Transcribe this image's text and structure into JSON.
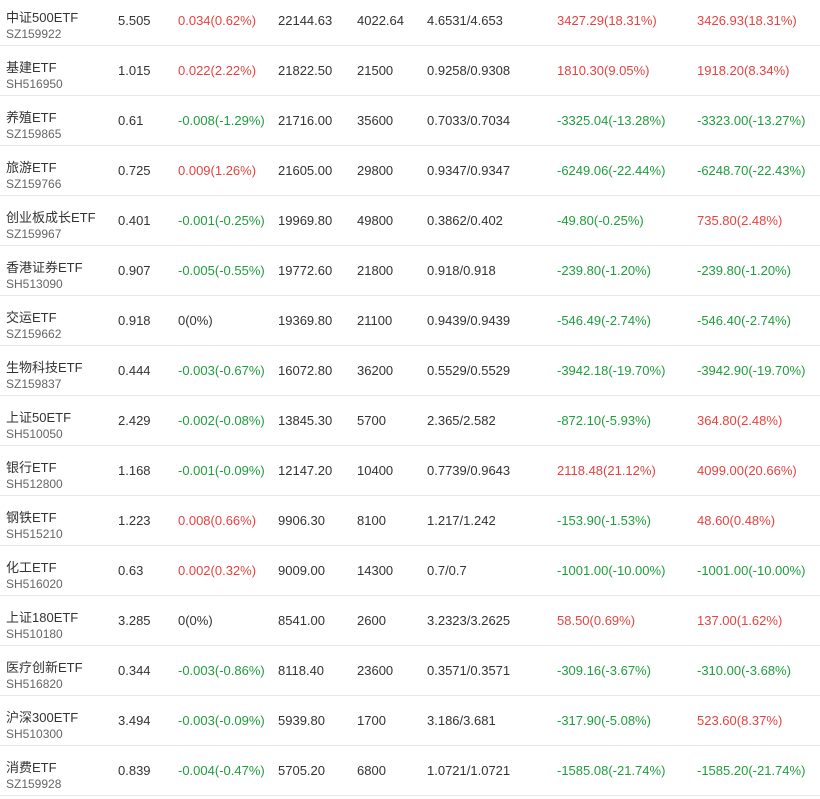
{
  "colors": {
    "up": "#e64340",
    "down": "#1e9e3c",
    "flat": "#333333"
  },
  "rows": [
    {
      "name": "中证500ETF",
      "code": "SZ159922",
      "price": "5.505",
      "change": "0.034(0.62%)",
      "change_dir": "up",
      "col3": "22144.63",
      "col4": "4022.64",
      "col5": "4.6531/4.653",
      "col6": "3427.29(18.31%)",
      "col6_dir": "up",
      "col7": "3426.93(18.31%)",
      "col7_dir": "up"
    },
    {
      "name": "基建ETF",
      "code": "SH516950",
      "price": "1.015",
      "change": "0.022(2.22%)",
      "change_dir": "up",
      "col3": "21822.50",
      "col4": "21500",
      "col5": "0.9258/0.9308",
      "col6": "1810.30(9.05%)",
      "col6_dir": "up",
      "col7": "1918.20(8.34%)",
      "col7_dir": "up"
    },
    {
      "name": "养殖ETF",
      "code": "SZ159865",
      "price": "0.61",
      "change": "-0.008(-1.29%)",
      "change_dir": "down",
      "col3": "21716.00",
      "col4": "35600",
      "col5": "0.7033/0.7034",
      "col6": "-3325.04(-13.28%)",
      "col6_dir": "down",
      "col7": "-3323.00(-13.27%)",
      "col7_dir": "down"
    },
    {
      "name": "旅游ETF",
      "code": "SZ159766",
      "price": "0.725",
      "change": "0.009(1.26%)",
      "change_dir": "up",
      "col3": "21605.00",
      "col4": "29800",
      "col5": "0.9347/0.9347",
      "col6": "-6249.06(-22.44%)",
      "col6_dir": "down",
      "col7": "-6248.70(-22.43%)",
      "col7_dir": "down"
    },
    {
      "name": "创业板成长ETF",
      "code": "SZ159967",
      "price": "0.401",
      "change": "-0.001(-0.25%)",
      "change_dir": "down",
      "col3": "19969.80",
      "col4": "49800",
      "col5": "0.3862/0.402",
      "col6": "-49.80(-0.25%)",
      "col6_dir": "down",
      "col7": "735.80(2.48%)",
      "col7_dir": "up"
    },
    {
      "name": "香港证券ETF",
      "code": "SH513090",
      "price": "0.907",
      "change": "-0.005(-0.55%)",
      "change_dir": "down",
      "col3": "19772.60",
      "col4": "21800",
      "col5": "0.918/0.918",
      "col6": "-239.80(-1.20%)",
      "col6_dir": "down",
      "col7": "-239.80(-1.20%)",
      "col7_dir": "down"
    },
    {
      "name": "交运ETF",
      "code": "SZ159662",
      "price": "0.918",
      "change": "0(0%)",
      "change_dir": "flat",
      "col3": "19369.80",
      "col4": "21100",
      "col5": "0.9439/0.9439",
      "col6": "-546.49(-2.74%)",
      "col6_dir": "down",
      "col7": "-546.40(-2.74%)",
      "col7_dir": "down"
    },
    {
      "name": "生物科技ETF",
      "code": "SZ159837",
      "price": "0.444",
      "change": "-0.003(-0.67%)",
      "change_dir": "down",
      "col3": "16072.80",
      "col4": "36200",
      "col5": "0.5529/0.5529",
      "col6": "-3942.18(-19.70%)",
      "col6_dir": "down",
      "col7": "-3942.90(-19.70%)",
      "col7_dir": "down"
    },
    {
      "name": "上证50ETF",
      "code": "SH510050",
      "price": "2.429",
      "change": "-0.002(-0.08%)",
      "change_dir": "down",
      "col3": "13845.30",
      "col4": "5700",
      "col5": "2.365/2.582",
      "col6": "-872.10(-5.93%)",
      "col6_dir": "down",
      "col7": "364.80(2.48%)",
      "col7_dir": "up"
    },
    {
      "name": "银行ETF",
      "code": "SH512800",
      "price": "1.168",
      "change": "-0.001(-0.09%)",
      "change_dir": "down",
      "col3": "12147.20",
      "col4": "10400",
      "col5": "0.7739/0.9643",
      "col6": "2118.48(21.12%)",
      "col6_dir": "up",
      "col7": "4099.00(20.66%)",
      "col7_dir": "up"
    },
    {
      "name": "钢铁ETF",
      "code": "SH515210",
      "price": "1.223",
      "change": "0.008(0.66%)",
      "change_dir": "up",
      "col3": "9906.30",
      "col4": "8100",
      "col5": "1.217/1.242",
      "col6": "-153.90(-1.53%)",
      "col6_dir": "down",
      "col7": "48.60(0.48%)",
      "col7_dir": "up"
    },
    {
      "name": "化工ETF",
      "code": "SH516020",
      "price": "0.63",
      "change": "0.002(0.32%)",
      "change_dir": "up",
      "col3": "9009.00",
      "col4": "14300",
      "col5": "0.7/0.7",
      "col6": "-1001.00(-10.00%)",
      "col6_dir": "down",
      "col7": "-1001.00(-10.00%)",
      "col7_dir": "down"
    },
    {
      "name": "上证180ETF",
      "code": "SH510180",
      "price": "3.285",
      "change": "0(0%)",
      "change_dir": "flat",
      "col3": "8541.00",
      "col4": "2600",
      "col5": "3.2323/3.2625",
      "col6": "58.50(0.69%)",
      "col6_dir": "up",
      "col7": "137.00(1.62%)",
      "col7_dir": "up"
    },
    {
      "name": "医疗创新ETF",
      "code": "SH516820",
      "price": "0.344",
      "change": "-0.003(-0.86%)",
      "change_dir": "down",
      "col3": "8118.40",
      "col4": "23600",
      "col5": "0.3571/0.3571",
      "col6": "-309.16(-3.67%)",
      "col6_dir": "down",
      "col7": "-310.00(-3.68%)",
      "col7_dir": "down"
    },
    {
      "name": "沪深300ETF",
      "code": "SH510300",
      "price": "3.494",
      "change": "-0.003(-0.09%)",
      "change_dir": "down",
      "col3": "5939.80",
      "col4": "1700",
      "col5": "3.186/3.681",
      "col6": "-317.90(-5.08%)",
      "col6_dir": "down",
      "col7": "523.60(8.37%)",
      "col7_dir": "up"
    },
    {
      "name": "消费ETF",
      "code": "SZ159928",
      "price": "0.839",
      "change": "-0.004(-0.47%)",
      "change_dir": "down",
      "col3": "5705.20",
      "col4": "6800",
      "col5": "1.0721/1.0721",
      "col6": "-1585.08(-21.74%)",
      "col6_dir": "down",
      "col7": "-1585.20(-21.74%)",
      "col7_dir": "down"
    }
  ]
}
